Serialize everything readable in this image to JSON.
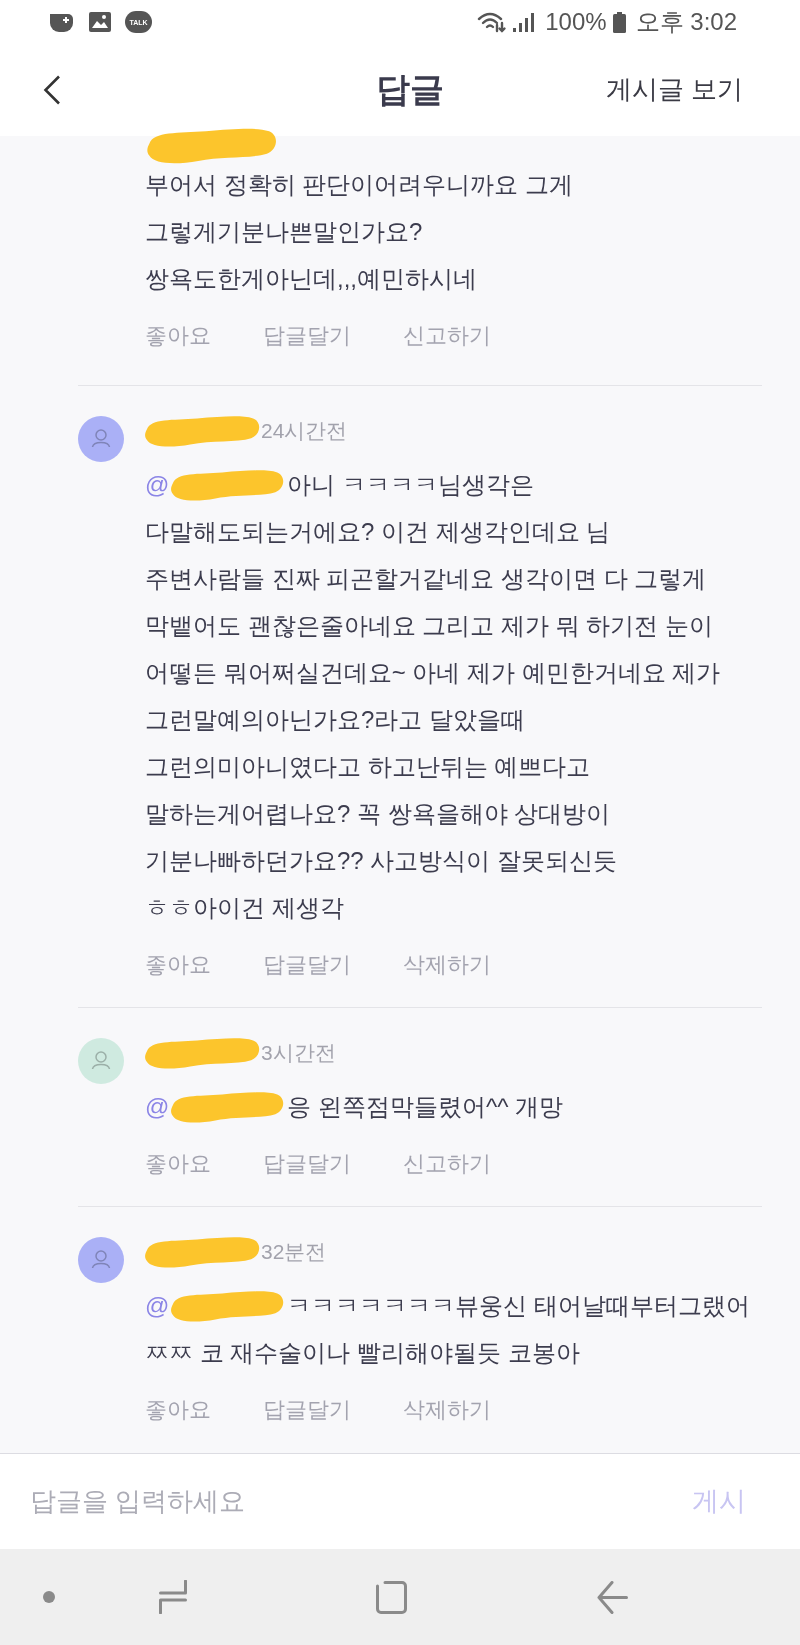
{
  "status_bar": {
    "badge": "TALK",
    "battery": "100%",
    "time": "오후 3:02"
  },
  "header": {
    "title": "답글",
    "link": "게시글 보기"
  },
  "comments": [
    {
      "kind": "cut_off",
      "lines": [
        "부어서 정확히 판단이어려우니까요 그게",
        "그렇게기분나쁜말인가요?",
        "쌍욕도한게아닌데,,,예민하시네"
      ],
      "actions": [
        "좋아요",
        "답글달기",
        "신고하기"
      ]
    },
    {
      "kind": "full",
      "color": "#aab0f6",
      "time": "24시간전",
      "mention": "@",
      "lines": [
        "아니 ㅋㅋㅋㅋ님생각은",
        "다말해도되는거에요? 이건 제생각인데요 님",
        "주변사람들 진짜 피곤할거같네요 생각이면 다 그렇게",
        "막뱉어도 괜찮은줄아네요 그리고 제가 뭐 하기전 눈이",
        "어떻든 뭐어쩌실건데요~ 아네 제가 예민한거네요 제가",
        "그런말예의아닌가요?라고 달았을때",
        "그런의미아니였다고 하고난뒤는 예쁘다고",
        "말하는게어렵나요? 꼭 쌍욕을해야 상대방이",
        "기분나빠하던가요?? 사고방식이 잘못되신듯",
        "ㅎㅎ아이건 제생각"
      ],
      "actions": [
        "좋아요",
        "답글달기",
        "삭제하기"
      ]
    },
    {
      "kind": "full",
      "color": "#cfeae0",
      "time": "3시간전",
      "mention": "@",
      "lines": [
        "응 왼쪽점막들렸어^^ 개망"
      ],
      "actions": [
        "좋아요",
        "답글달기",
        "신고하기"
      ]
    },
    {
      "kind": "full",
      "color": "#aab0f6",
      "time": "32분전",
      "mention": "@",
      "lines": [
        "ㅋㅋㅋㅋㅋㅋㅋ뷰웅신 태어날때부터그랬어",
        "ㅉㅉ 코 재수술이나 빨리해야될듯 코봉아"
      ],
      "actions": [
        "좋아요",
        "답글달기",
        "삭제하기"
      ]
    }
  ],
  "reply_bar": {
    "placeholder": "답글을 입력하세요",
    "post_button": {
      "label": "게시",
      "disabled": true
    }
  }
}
